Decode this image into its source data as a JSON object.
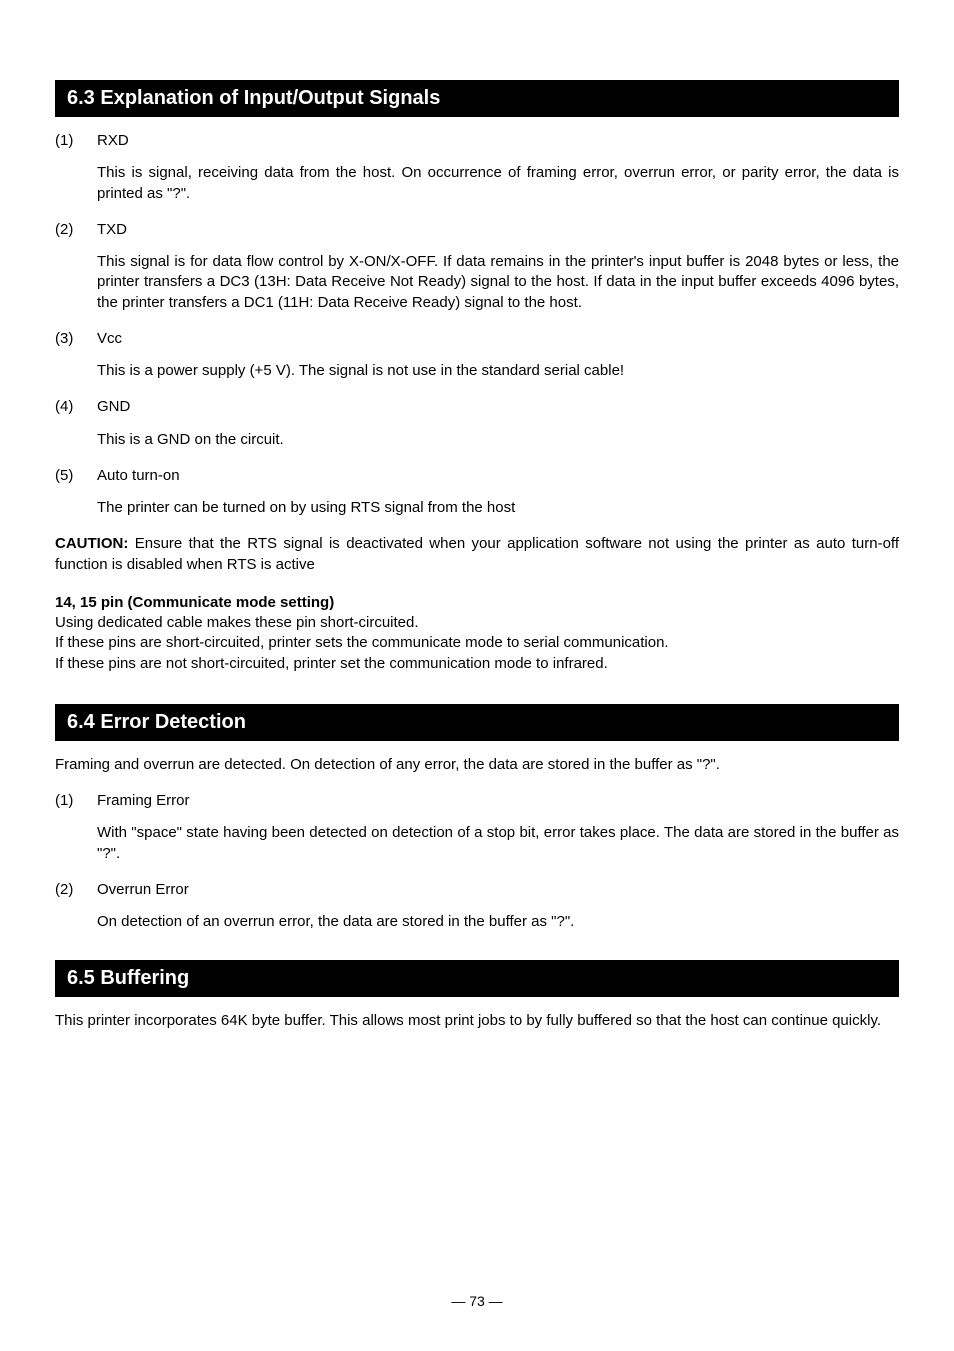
{
  "section_6_3": {
    "header": "6.3  Explanation of Input/Output Signals",
    "items": [
      {
        "num": "(1)",
        "title": "RXD",
        "body": "This is signal, receiving data from the host.  On occurrence of framing error, overrun error, or parity error, the data is printed as \"?\"."
      },
      {
        "num": "(2)",
        "title": "TXD",
        "body": "This signal is for data flow control by X-ON/X-OFF.  If data remains in the printer's input buffer is 2048 bytes or less, the printer transfers a DC3 (13H: Data Receive Not Ready) signal to the host.  If data in the input buffer exceeds 4096 bytes, the printer transfers a DC1 (11H: Data Receive Ready) signal to the host."
      },
      {
        "num": "(3)",
        "title": "Vcc",
        "body": "This is a power supply (+5 V).  The signal is not use in the standard serial cable!"
      },
      {
        "num": "(4)",
        "title": "GND",
        "body": "This is a GND on the circuit."
      },
      {
        "num": "(5)",
        "title": "Auto turn-on",
        "body": "The printer can be turned on by using RTS signal from the host"
      }
    ],
    "caution_label": "CAUTION:",
    "caution_text": " Ensure that the RTS signal is deactivated when your application software not using the printer as auto turn-off function is disabled when RTS is active",
    "pins_title": "14, 15 pin (Communicate mode setting)",
    "pins_line1": "Using dedicated cable makes these pin short-circuited.",
    "pins_line2": "If these pins are short-circuited, printer sets the communicate mode to serial communication.",
    "pins_line3": "If these pins are not short-circuited, printer set the communication mode to infrared."
  },
  "section_6_4": {
    "header": "6.4 Error Detection",
    "intro": "Framing and overrun are detected.  On detection of any error, the data are stored in the buffer as \"?\".",
    "items": [
      {
        "num": "(1)",
        "title": "Framing Error",
        "body": "With \"space\" state having been detected on detection of a stop bit, error takes place.  The data are stored in the buffer as \"?\"."
      },
      {
        "num": "(2)",
        "title": "Overrun Error",
        "body": "On detection of an overrun error, the data are stored in the buffer as \"?\"."
      }
    ]
  },
  "section_6_5": {
    "header": "6.5 Buffering",
    "body": "This printer incorporates 64K byte buffer.  This allows most print jobs to by fully buffered so that the host can continue quickly."
  },
  "page_number": "— 73 —"
}
